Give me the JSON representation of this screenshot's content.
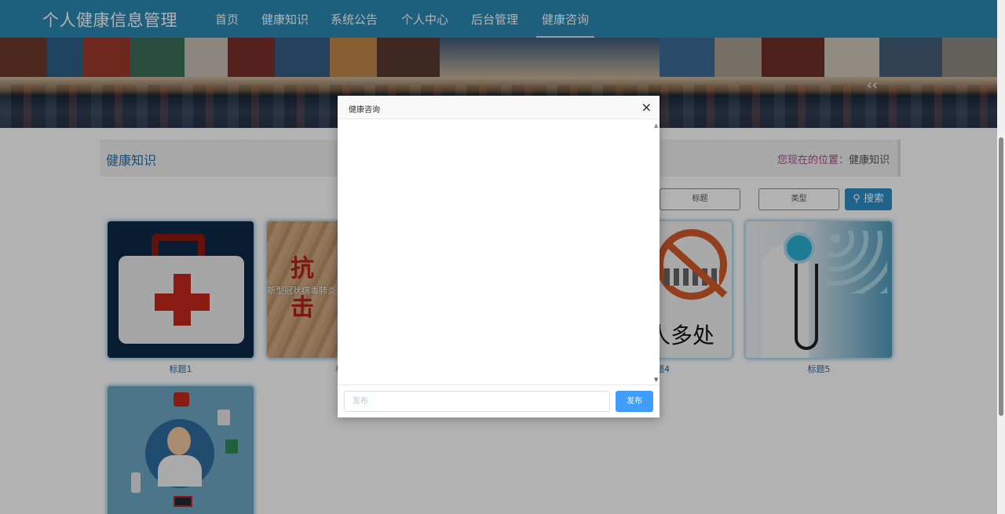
{
  "brand": "个人健康信息管理",
  "nav": [
    {
      "label": "首页"
    },
    {
      "label": "健康知识"
    },
    {
      "label": "系统公告"
    },
    {
      "label": "个人中心"
    },
    {
      "label": "后台管理"
    },
    {
      "label": "健康咨询",
      "active": true
    }
  ],
  "breadcrumb": {
    "title": "健康知识",
    "location_prefix": "您现在的位置：",
    "location_current": "健康知识"
  },
  "filters": {
    "title_placeholder": "标题",
    "type_placeholder": "类型",
    "search_label": "搜索"
  },
  "cards": [
    {
      "caption": "标题1",
      "image": "first-aid-kit"
    },
    {
      "caption": "标",
      "image": "anti-epidemic-text"
    },
    {
      "caption": "",
      "image": "hidden"
    },
    {
      "caption": "题4",
      "image": "no-crowd-sign"
    },
    {
      "caption": "标题5",
      "image": "doctor-stethoscope"
    },
    {
      "caption": "",
      "image": "doctor-illustration"
    }
  ],
  "card_texts": {
    "anti_epidemic_big": "抗\n击",
    "anti_epidemic_small": "新型冠状病毒肺炎",
    "no_crowd_text": "人多处"
  },
  "modal": {
    "title": "健康咨询",
    "close_symbol": "×",
    "input_placeholder": "发布",
    "input_value": "",
    "send_label": "发布"
  },
  "colors": {
    "nav_bg": "#2a88b2",
    "accent": "#409eff",
    "search_bg": "#2f8fc6"
  }
}
